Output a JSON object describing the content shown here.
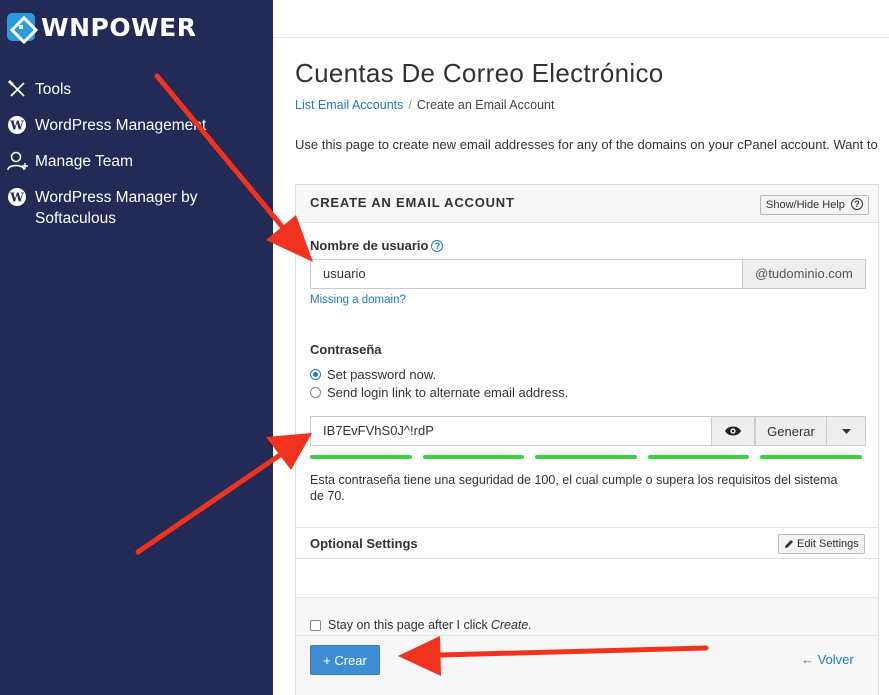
{
  "brand": {
    "name": "WNPOWER"
  },
  "sidebar": {
    "items": [
      {
        "label": "Tools",
        "icon": "tools-icon"
      },
      {
        "label": "WordPress Management",
        "icon": "wordpress-icon"
      },
      {
        "label": "Manage Team",
        "icon": "team-icon"
      },
      {
        "label": "WordPress Manager by Softaculous",
        "icon": "wordpress-icon"
      }
    ]
  },
  "page": {
    "title": "Cuentas De Correo Electrónico",
    "intro": "Use this page to create new email addresses for any of the domains on your cPanel account. Want to"
  },
  "breadcrumb": {
    "parent": "List Email Accounts",
    "sep": "/",
    "current": "Create an Email Account"
  },
  "form": {
    "panel_title": "CREATE AN EMAIL ACCOUNT",
    "help_button": "Show/Hide Help",
    "username_label": "Nombre de usuario",
    "username_value": "usuario",
    "domain": "@tudominio.com",
    "missing_domain": "Missing a domain?",
    "password_label": "Contraseña",
    "radio_set_now": "Set password now.",
    "radio_send_link": "Send login link to alternate email address.",
    "password_value": "IB7EvFVhS0J^!rdP",
    "generate_button": "Generar",
    "strength_segments": 5,
    "strength_text": "Esta contraseña tiene una seguridad de 100, el cual cumple o supera los requisitos del sistema de 70.",
    "optional_settings": "Optional Settings",
    "edit_settings": "Edit Settings",
    "stay_label": "Stay on this page after I click",
    "stay_create": "Create.",
    "create_button": "+ Crear",
    "back_link": "← Volver"
  },
  "colors": {
    "sidebar_bg": "#222a55",
    "accent": "#3d8fd1",
    "link": "#1f7ac2",
    "strength": "#3ecf3e",
    "annotation_arrow": "#f0321e"
  }
}
